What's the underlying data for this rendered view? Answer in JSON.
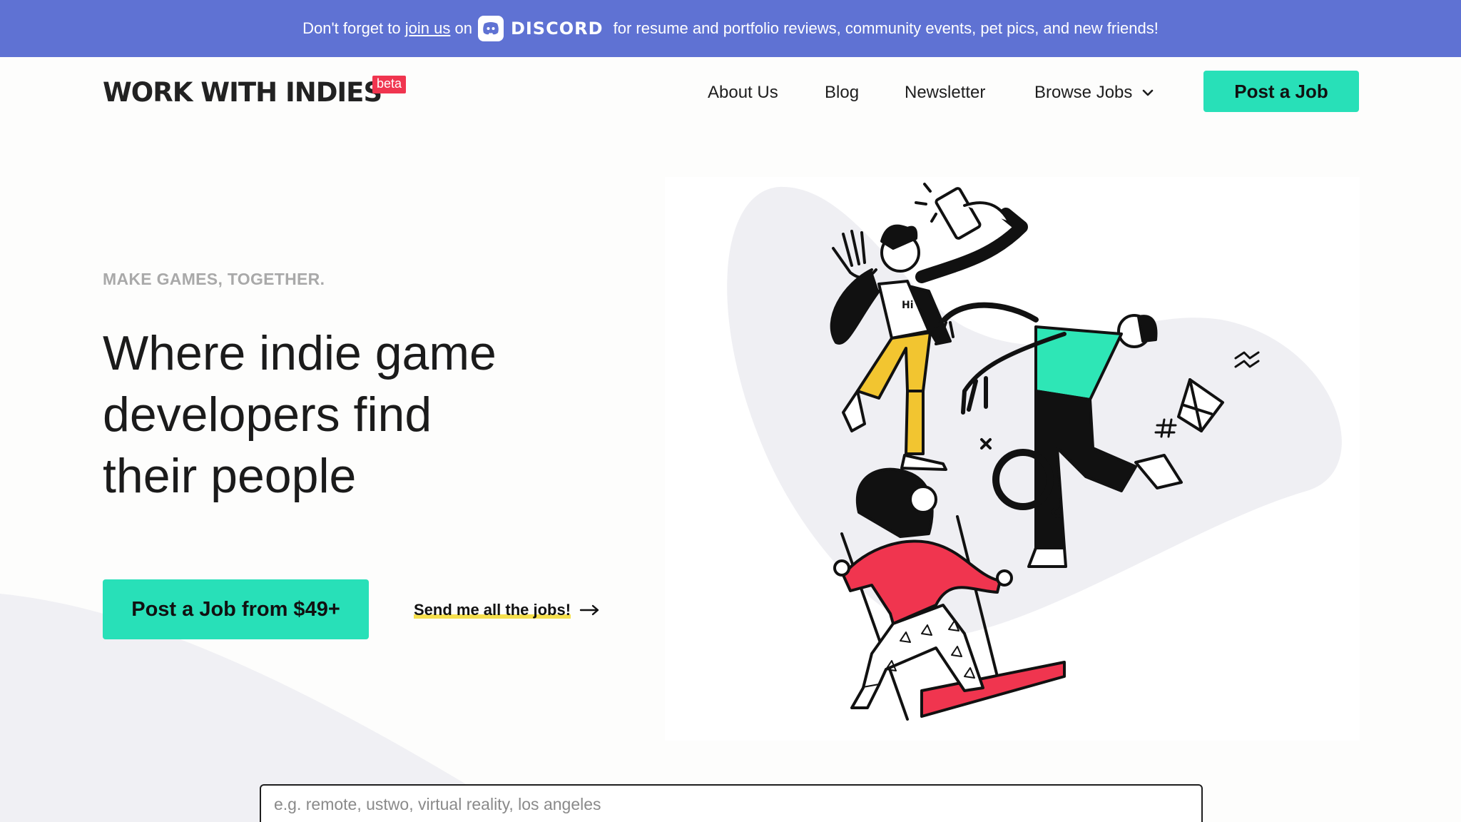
{
  "announcement": {
    "before": "Don't forget to ",
    "link": "join us",
    "on": " on",
    "brand": "DISCORD",
    "after": " for resume and portfolio reviews, community events, pet pics, and new friends!",
    "bg_color": "#5f72d3"
  },
  "header": {
    "logo": "WORK WITH INDIES",
    "badge": "beta",
    "nav": [
      "About Us",
      "Blog",
      "Newsletter",
      "Browse Jobs"
    ],
    "post_job": "Post a Job"
  },
  "hero": {
    "eyebrow": "MAKE GAMES, TOGETHER.",
    "headline_lines": [
      "Where indie game",
      "developers find",
      "their people"
    ],
    "cta": "Post a Job from $49+",
    "secondary": "Send me all the jobs!"
  },
  "search": {
    "placeholder": "e.g. remote, ustwo, virtual reality, los angeles",
    "value": ""
  },
  "illustration": {
    "shirt_text": "Hi"
  },
  "colors": {
    "accent": "#28e0b8",
    "beta": "#f0354f",
    "highlight": "#f5df4d",
    "pants_yellow": "#f2c530",
    "swing_red": "#f0354f"
  }
}
